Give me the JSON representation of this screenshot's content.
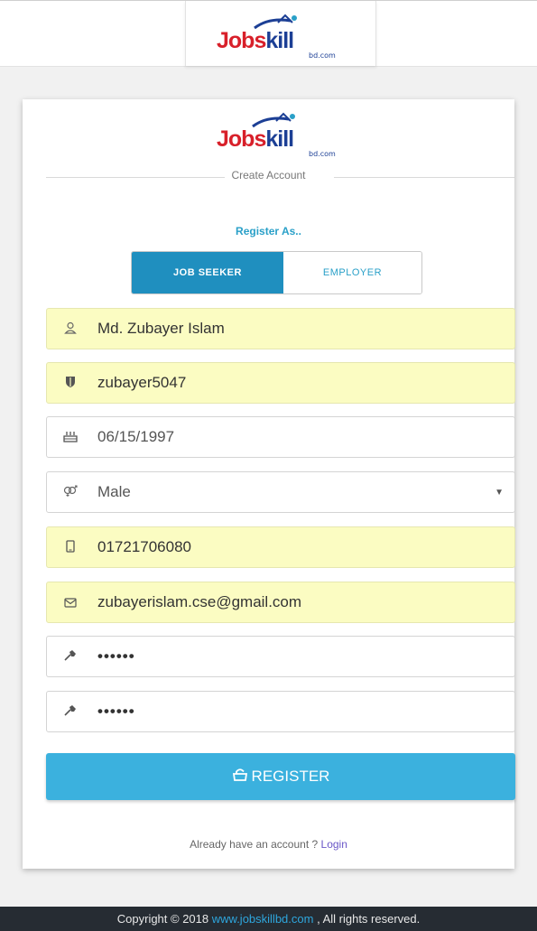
{
  "brand": {
    "logo_main_red": "Jobs",
    "logo_main_blue": "kill",
    "logo_sub": "bd.com"
  },
  "form": {
    "title": "Create Account",
    "register_as_label": "Register As..",
    "toggle": {
      "job_seeker": "JOB SEEKER",
      "employer": "EMPLOYER",
      "selected": "job_seeker"
    },
    "fields": {
      "full_name": {
        "value": "Md. Zubayer Islam",
        "icon": "user-icon"
      },
      "username": {
        "value": "zubayer5047",
        "icon": "shield-icon"
      },
      "birth_date": {
        "value": "06/15/1997",
        "icon": "cake-icon"
      },
      "gender": {
        "value": "Male",
        "icon": "gender-icon"
      },
      "phone": {
        "value": "01721706080",
        "icon": "phone-icon"
      },
      "email": {
        "value": "zubayerislam.cse@gmail.com",
        "icon": "envelope-icon"
      },
      "password": {
        "value": "••••••",
        "icon": "key-icon"
      },
      "confirm_password": {
        "value": "••••••",
        "icon": "key-icon"
      }
    },
    "register_button": "REGISTER",
    "login_prompt": "Already have an account ?",
    "login_link": "Login"
  },
  "footer": {
    "prefix": "Copyright © 2018",
    "link": "www.jobskillbd.com",
    "suffix": ", All rights reserved."
  },
  "colors": {
    "accent": "#1f8fbf",
    "register_button": "#3bb1de",
    "autofill_bg": "#fbfcc2",
    "footer_bg": "#262c33",
    "logo_red": "#d8202a",
    "logo_blue": "#1c3f95"
  }
}
